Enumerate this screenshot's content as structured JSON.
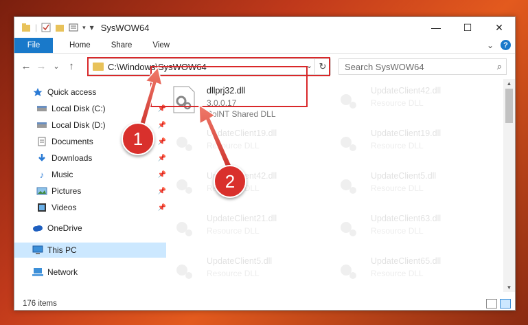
{
  "window": {
    "title": "SysWOW64",
    "controls": {
      "minimize": "—",
      "maximize": "☐",
      "close": "✕"
    }
  },
  "ribbon": {
    "tabs": [
      "File",
      "Home",
      "Share",
      "View"
    ],
    "expand": "⌄",
    "help": "?"
  },
  "address": {
    "path": "C:\\Windows\\SysWOW64",
    "back": "←",
    "forward": "→",
    "recent": "⌄",
    "up": "↑",
    "refresh": "↻",
    "dropdown": "⌄"
  },
  "search": {
    "placeholder": "Search SysWOW64",
    "icon": "⌕"
  },
  "nav": {
    "items": [
      {
        "label": "Quick access",
        "icon": "star-icon"
      },
      {
        "label": "Local Disk (C:)",
        "icon": "drive-icon",
        "pinned": true
      },
      {
        "label": "Local Disk (D:)",
        "icon": "drive-icon",
        "pinned": true
      },
      {
        "label": "Documents",
        "icon": "documents-icon",
        "pinned": true
      },
      {
        "label": "Downloads",
        "icon": "download-icon",
        "pinned": true
      },
      {
        "label": "Music",
        "icon": "music-icon",
        "pinned": true
      },
      {
        "label": "Pictures",
        "icon": "pictures-icon",
        "pinned": true
      },
      {
        "label": "Videos",
        "icon": "video-icon",
        "pinned": true
      },
      {
        "label": "OneDrive",
        "icon": "cloud-icon"
      },
      {
        "label": "This PC",
        "icon": "pc-icon",
        "selected": true
      },
      {
        "label": "Network",
        "icon": "network-icon"
      }
    ]
  },
  "files": {
    "highlighted": {
      "name": "dllprj32.dll",
      "version": "3.0.0.17",
      "description": "PolNT Shared DLL"
    },
    "left": [
      {
        "name": "UpdateClient19.dll",
        "description": "Resource DLL"
      },
      {
        "name": "UpdateClient42.dll",
        "description": "Resource DLL"
      },
      {
        "name": "UpdateClient21.dll",
        "description": "Resource DLL"
      },
      {
        "name": "UpdateClient5.dll",
        "description": "Resource DLL"
      }
    ],
    "right": [
      {
        "name": "UpdateClient42.dll",
        "description": "Resource DLL"
      },
      {
        "name": "UpdateClient19.dll",
        "description": "Resource DLL"
      },
      {
        "name": "UpdateClient5.dll",
        "description": "Resource DLL"
      },
      {
        "name": "UpdateClient63.dll",
        "description": "Resource DLL"
      },
      {
        "name": "UpdateClient65.dll",
        "description": "Resource DLL"
      }
    ]
  },
  "status": {
    "count": "176 items"
  },
  "annotations": {
    "badge1": "1",
    "badge2": "2"
  },
  "colors": {
    "accent": "#1979ca",
    "highlight": "#d9282a",
    "selection": "#cce8ff"
  }
}
